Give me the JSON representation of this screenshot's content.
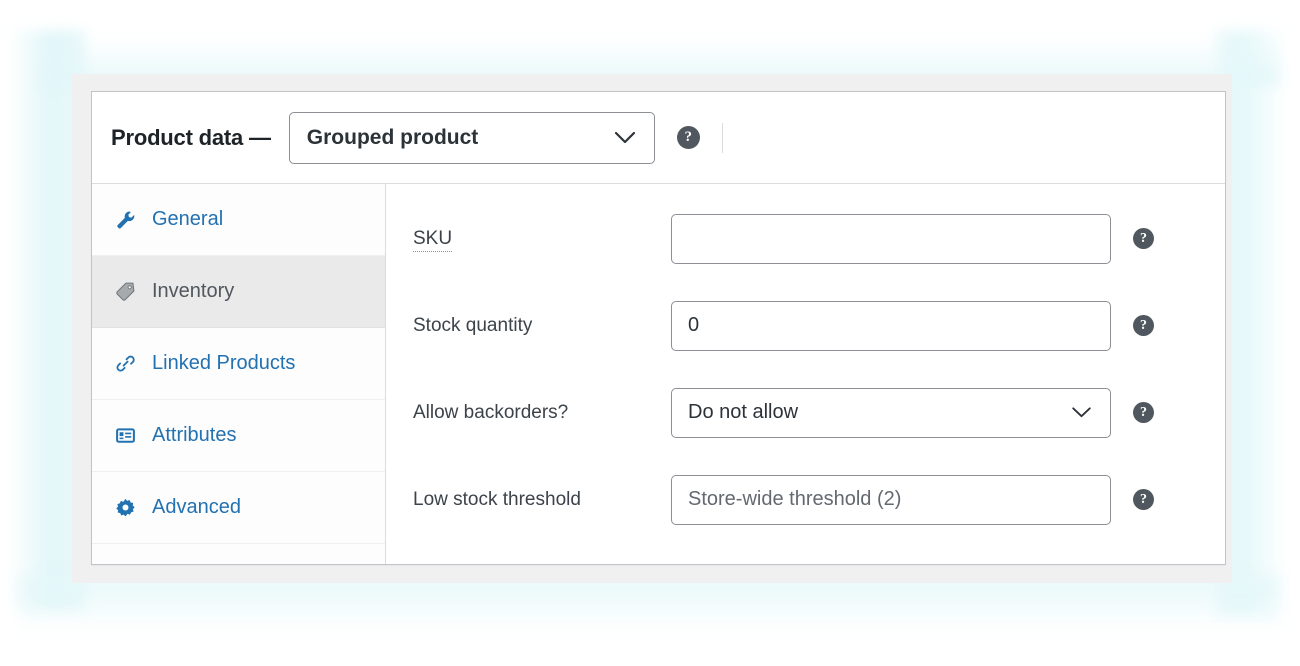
{
  "panel": {
    "title": "Product data —",
    "product_type": {
      "selected": "Grouped product",
      "chevron_icon": "chevron-down-icon"
    },
    "help_icon": "help-tip-icon",
    "help_glyph": "?"
  },
  "tabs": [
    {
      "id": "general",
      "label": "General",
      "icon": "wrench-icon",
      "active": false
    },
    {
      "id": "inventory",
      "label": "Inventory",
      "icon": "tag-icon",
      "active": true
    },
    {
      "id": "linked-products",
      "label": "Linked Products",
      "icon": "link-icon",
      "active": false
    },
    {
      "id": "attributes",
      "label": "Attributes",
      "icon": "list-box-icon",
      "active": false
    },
    {
      "id": "advanced",
      "label": "Advanced",
      "icon": "gear-icon",
      "active": false
    }
  ],
  "fields": {
    "sku": {
      "label": "SKU",
      "value": "",
      "placeholder": "",
      "help_glyph": "?"
    },
    "stock_quantity": {
      "label": "Stock quantity",
      "value": "0",
      "help_glyph": "?"
    },
    "allow_backorders": {
      "label": "Allow backorders?",
      "selected": "Do not allow",
      "chevron_icon": "chevron-down-icon",
      "help_glyph": "?"
    },
    "low_stock_threshold": {
      "label": "Low stock threshold",
      "value": "",
      "placeholder": "Store-wide threshold (2)",
      "help_glyph": "?"
    }
  },
  "colors": {
    "link_blue": "#2271b1",
    "text_dark": "#1d2327",
    "label_gray": "#3c434a",
    "placeholder_gray": "#646970",
    "border_gray": "#8c8f94",
    "active_tab_bg": "#eaeaea",
    "panel_bg": "#f0f0f1",
    "glow_cyan": "#e2f7f9"
  }
}
